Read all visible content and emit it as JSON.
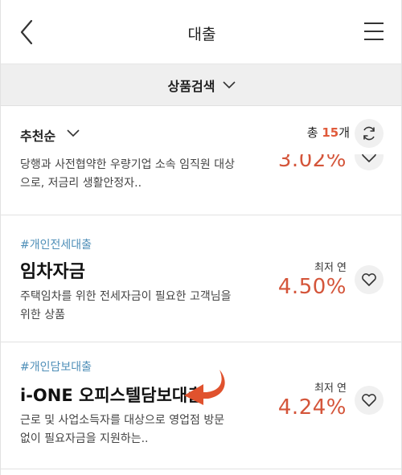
{
  "header": {
    "title": "대출",
    "back_icon": "chevron-left-icon",
    "menu_icon": "hamburger-menu-icon"
  },
  "search": {
    "label": "상품검색",
    "icon": "chevron-down-icon"
  },
  "sort": {
    "label": "추천순",
    "total_prefix": "총 ",
    "total_count": "15",
    "total_suffix": "개",
    "refresh_icon": "refresh-icon"
  },
  "products": [
    {
      "tag": "",
      "name": "",
      "desc_line1": "당행과 사전협약한 우량기업 소속 임직원 대상",
      "desc_line2": "으로, 저금리 생활안정자..",
      "rate_label": "",
      "rate": "3.02%"
    },
    {
      "tag": "#개인전세대출",
      "name": "임차자금",
      "desc_line1": "주택임차를 위한 전세자금이 필요한 고객님을",
      "desc_line2": "위한 상품",
      "rate_label": "최저 연",
      "rate": "4.50%"
    },
    {
      "tag": "#개인담보대출",
      "name": "i-ONE 오피스텔담보대출",
      "desc_line1": "근로 및 사업소득자를 대상으로 영업점 방문",
      "desc_line2": "없이 필요자금을 지원하는..",
      "rate_label": "최저 연",
      "rate": "4.24%"
    }
  ],
  "colors": {
    "accent": "#d4553a",
    "tag": "#4f8fb8",
    "arrow": "#e0522e"
  }
}
